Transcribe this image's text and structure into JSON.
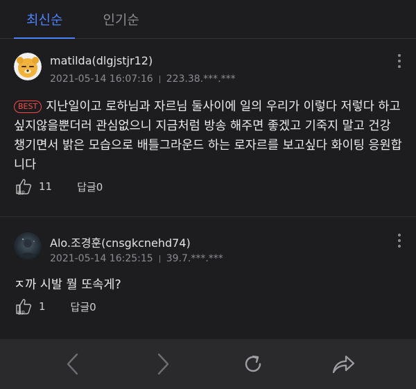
{
  "tabs": [
    {
      "label": "최신순",
      "active": true
    },
    {
      "label": "인기순",
      "active": false
    }
  ],
  "comments": [
    {
      "nickname": "matilda(dlgjstjr12)",
      "date": "2021-05-14 16:07:16",
      "ip": "223.38.***.***",
      "best_label": "BEST",
      "text": "지난일이고 로하님과 자르님 둘사이에 일의 우리가 이렇다 저렇다 하고싶지않을뿐더러 관심없으니 지금처럼 방송 해주면 좋겠고 기죽지 말고 건강 챙기면서 밝은 모습으로 배틀그라운드 하는 로자르를 보고싶다 화이팅 응원합니다",
      "likes": "11",
      "reply_label": "답글0",
      "avatar_icon": "character-avatar-icon"
    },
    {
      "nickname": "Alo.조경훈(cnsgkcnehd74)",
      "date": "2021-05-14 16:25:15",
      "ip": "39.7.***.***",
      "text": "ㅈ까 시발 뭘 또속게?",
      "likes": "1",
      "reply_label": "답글0",
      "avatar_icon": "photo-avatar-icon"
    }
  ],
  "bottom_bar": {
    "icons": [
      "back-icon",
      "forward-icon",
      "refresh-icon",
      "share-icon"
    ]
  },
  "colors": {
    "background": "#1d1d1f",
    "accent": "#4d82ff",
    "best": "#ff4a4a",
    "toolbar": "#2a2a2c"
  }
}
